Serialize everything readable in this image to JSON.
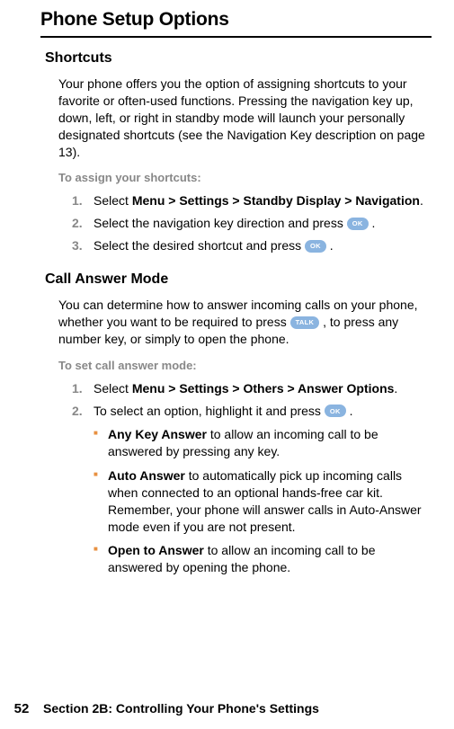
{
  "title": "Phone Setup Options",
  "shortcuts": {
    "heading": "Shortcuts",
    "intro": "Your phone offers you the option of assigning shortcuts to your favorite or often-used functions. Pressing the navigation key up, down, left, or right in standby mode will launch your personally designated shortcuts (see the Navigation Key description on page 13).",
    "instr_title": "To assign your shortcuts:",
    "step1_a": "Select ",
    "step1_b": "Menu > Settings > Standby Display > Navigation",
    "step1_c": ".",
    "step2_a": "Select the navigation key direction and press ",
    "step2_c": " .",
    "step3_a": "Select the desired shortcut and press ",
    "step3_c": " ."
  },
  "answer": {
    "heading": "Call Answer Mode",
    "intro_a": "You can determine how to answer incoming calls on your phone, whether you want to be required to press ",
    "intro_b": " , to press any number key, or simply to open the phone.",
    "instr_title": "To set call answer mode:",
    "step1_a": "Select ",
    "step1_b": "Menu > Settings > Others > Answer Options",
    "step1_c": ".",
    "step2_a": "To select an option, highlight it and press ",
    "step2_c": " .",
    "sub1_a": "Any Key Answer",
    "sub1_b": " to allow an incoming call to be answered by pressing any key.",
    "sub2_a": "Auto Answer",
    "sub2_b": " to automatically pick up incoming calls when connected to an optional hands-free car kit. Remember, your phone will answer calls in Auto-Answer mode even if you are not present.",
    "sub3_a": "Open to Answer",
    "sub3_b": " to allow an incoming call to be answered by opening the phone."
  },
  "keys": {
    "ok": "OK",
    "talk": "TALK"
  },
  "footer": {
    "page": "52",
    "section": "Section 2B: Controlling Your Phone's Settings"
  }
}
